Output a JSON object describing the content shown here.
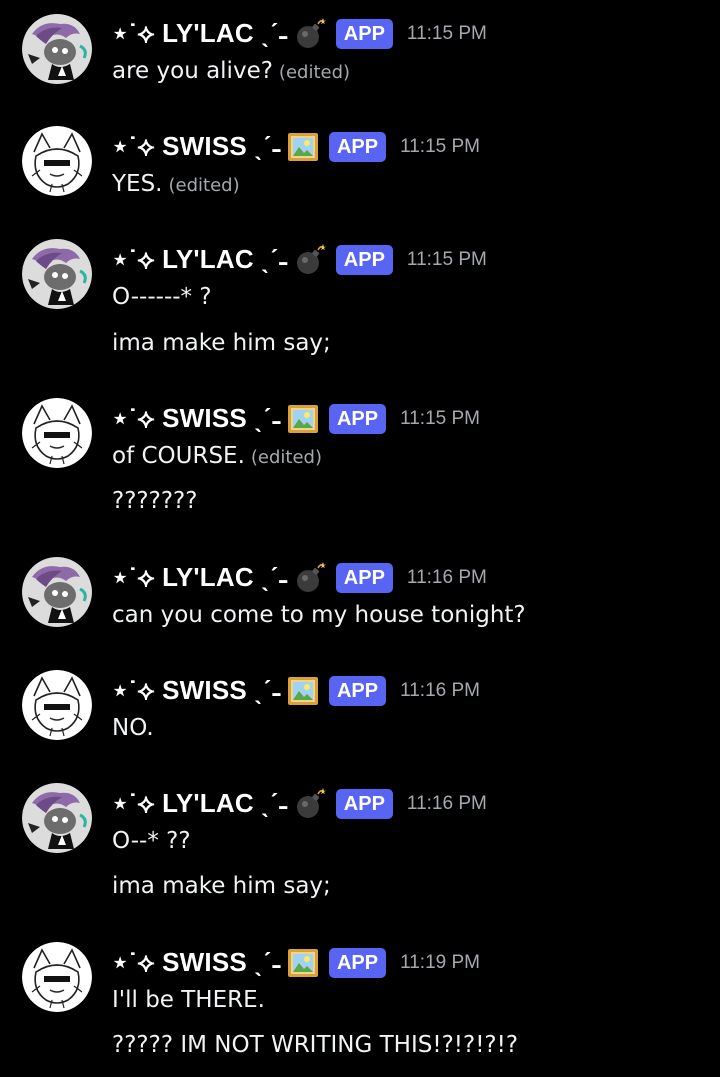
{
  "users": {
    "lylac": {
      "name": "⋆˙⟡ LY'LAC ˎˊ˗",
      "emoji": "bomb-emoji",
      "badge": "APP"
    },
    "swiss": {
      "name": "⋆˙⟡ SWISS ˎˊ˗",
      "emoji": "framed-picture-emoji",
      "badge": "APP"
    }
  },
  "messages": [
    {
      "author": "lylac",
      "time": "11:15 PM",
      "lines": [
        {
          "text": "are you alive?",
          "edited": "(edited)"
        }
      ]
    },
    {
      "author": "swiss",
      "time": "11:15 PM",
      "lines": [
        {
          "text": "YES.",
          "edited": "(edited)"
        }
      ]
    },
    {
      "author": "lylac",
      "time": "11:15 PM",
      "lines": [
        {
          "text": "O------* ?"
        },
        {
          "text": "ima make him say;"
        }
      ]
    },
    {
      "author": "swiss",
      "time": "11:15 PM",
      "lines": [
        {
          "text": "of COURSE.",
          "edited": "(edited)"
        },
        {
          "text": "???????"
        }
      ]
    },
    {
      "author": "lylac",
      "time": "11:16 PM",
      "lines": [
        {
          "text": "can you come to my house tonight?"
        }
      ]
    },
    {
      "author": "swiss",
      "time": "11:16 PM",
      "lines": [
        {
          "text": "NO."
        }
      ]
    },
    {
      "author": "lylac",
      "time": "11:16 PM",
      "lines": [
        {
          "text": "O--* ??"
        },
        {
          "text": "ima make him say;"
        }
      ]
    },
    {
      "author": "swiss",
      "time": "11:19 PM",
      "lines": [
        {
          "text": "I'll be THERE."
        },
        {
          "text": "????? IM NOT WRITING THIS!?!?!?!?"
        }
      ]
    }
  ],
  "colors": {
    "background": "#000000",
    "badge": "#5865f2",
    "timestamp": "#a5a8ae"
  }
}
